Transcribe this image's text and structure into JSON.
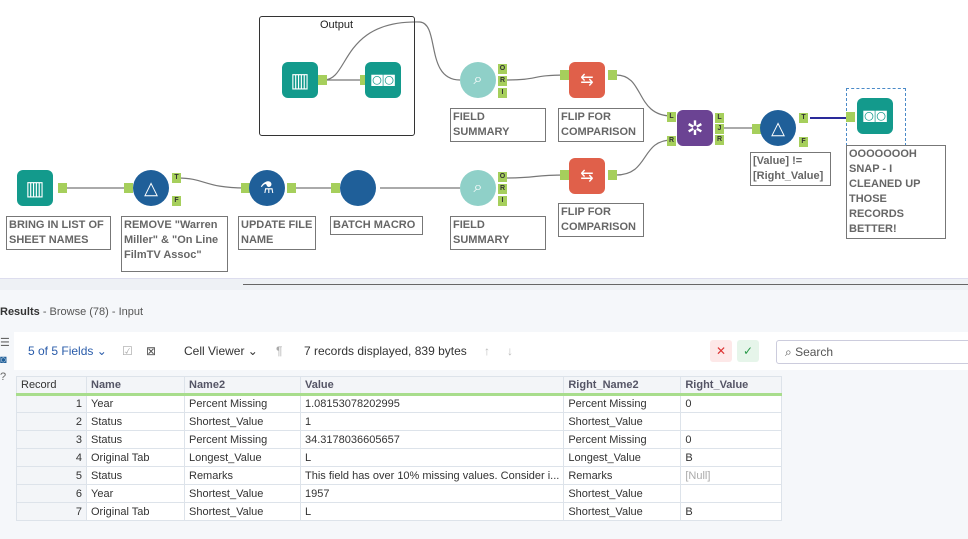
{
  "workflow": {
    "container_title": "Output",
    "labels": {
      "field_summary_top": "FIELD SUMMARY",
      "flip_top": "FLIP FOR COMPARISON",
      "filter_right": "[Value] != [Right_Value]",
      "browse_right": "OOOOOOOH SNAP - I CLEANED UP THOSE RECORDS BETTER!",
      "input": "BRING IN LIST OF SHEET NAMES",
      "filter_left": "REMOVE \"Warren Miller\" & \"On Line FilmTV Assoc\"",
      "formula": "UPDATE FILE NAME",
      "batch": "BATCH MACRO",
      "field_summary_bottom": "FIELD SUMMARY",
      "flip_bottom": "FLIP FOR COMPARISON"
    },
    "colors": {
      "teal": "#139a8c",
      "blue": "#1f5f99",
      "orange": "#e0604a",
      "purple": "#6b4393",
      "summary": "#8fd0c8",
      "anchor": "#a6cf5c"
    }
  },
  "results": {
    "title": "Results",
    "subtitle": "- Browse (78) - Input",
    "fields": "5 of 5 Fields",
    "viewer": "Cell Viewer",
    "status": "7 records displayed, 839 bytes",
    "search_placeholder": "Search",
    "columns": [
      "Record",
      "Name",
      "Name2",
      "Value",
      "Right_Name2",
      "Right_Value"
    ],
    "rows": [
      [
        "1",
        "Year",
        "Percent Missing",
        "1.08153078202995",
        "Percent Missing",
        "0"
      ],
      [
        "2",
        "Status",
        "Shortest_Value",
        "1",
        "Shortest_Value",
        ""
      ],
      [
        "3",
        "Status",
        "Percent Missing",
        "34.3178036605657",
        "Percent Missing",
        "0"
      ],
      [
        "4",
        "Original Tab",
        "Longest_Value",
        "L",
        "Longest_Value",
        "B"
      ],
      [
        "5",
        "Status",
        "Remarks",
        "This field has over 10% missing values. Consider i...",
        "Remarks",
        "[Null]"
      ],
      [
        "6",
        "Year",
        "Shortest_Value",
        "1957",
        "Shortest_Value",
        ""
      ],
      [
        "7",
        "Original Tab",
        "Shortest_Value",
        "L",
        "Shortest_Value",
        "B"
      ]
    ]
  }
}
